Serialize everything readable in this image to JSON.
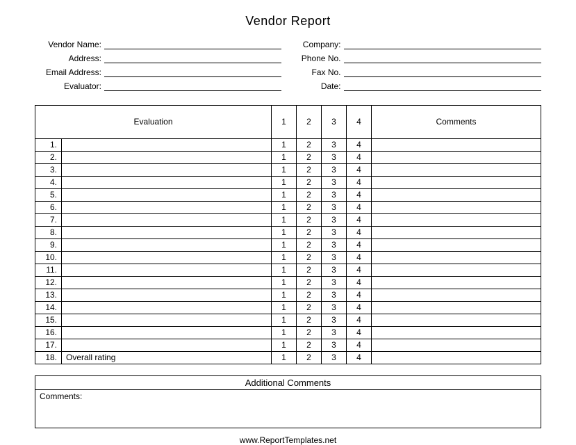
{
  "title": "Vendor Report",
  "info_left": [
    {
      "label": "Vendor Name:",
      "value": ""
    },
    {
      "label": "Address:",
      "value": ""
    },
    {
      "label": "Email Address:",
      "value": ""
    },
    {
      "label": "Evaluator:",
      "value": ""
    }
  ],
  "info_right": [
    {
      "label": "Company:",
      "value": ""
    },
    {
      "label": "Phone No.",
      "value": ""
    },
    {
      "label": "Fax No.",
      "value": ""
    },
    {
      "label": "Date:",
      "value": ""
    }
  ],
  "headers": {
    "evaluation": "Evaluation",
    "r1": "1",
    "r2": "2",
    "r3": "3",
    "r4": "4",
    "comments": "Comments"
  },
  "rows": [
    {
      "num": "1.",
      "label": "",
      "r1": "1",
      "r2": "2",
      "r3": "3",
      "r4": "4",
      "comments": ""
    },
    {
      "num": "2.",
      "label": "",
      "r1": "1",
      "r2": "2",
      "r3": "3",
      "r4": "4",
      "comments": ""
    },
    {
      "num": "3.",
      "label": "",
      "r1": "1",
      "r2": "2",
      "r3": "3",
      "r4": "4",
      "comments": ""
    },
    {
      "num": "4.",
      "label": "",
      "r1": "1",
      "r2": "2",
      "r3": "3",
      "r4": "4",
      "comments": ""
    },
    {
      "num": "5.",
      "label": "",
      "r1": "1",
      "r2": "2",
      "r3": "3",
      "r4": "4",
      "comments": ""
    },
    {
      "num": "6.",
      "label": "",
      "r1": "1",
      "r2": "2",
      "r3": "3",
      "r4": "4",
      "comments": ""
    },
    {
      "num": "7.",
      "label": "",
      "r1": "1",
      "r2": "2",
      "r3": "3",
      "r4": "4",
      "comments": ""
    },
    {
      "num": "8.",
      "label": "",
      "r1": "1",
      "r2": "2",
      "r3": "3",
      "r4": "4",
      "comments": ""
    },
    {
      "num": "9.",
      "label": "",
      "r1": "1",
      "r2": "2",
      "r3": "3",
      "r4": "4",
      "comments": ""
    },
    {
      "num": "10.",
      "label": "",
      "r1": "1",
      "r2": "2",
      "r3": "3",
      "r4": "4",
      "comments": ""
    },
    {
      "num": "11.",
      "label": "",
      "r1": "1",
      "r2": "2",
      "r3": "3",
      "r4": "4",
      "comments": ""
    },
    {
      "num": "12.",
      "label": "",
      "r1": "1",
      "r2": "2",
      "r3": "3",
      "r4": "4",
      "comments": ""
    },
    {
      "num": "13.",
      "label": "",
      "r1": "1",
      "r2": "2",
      "r3": "3",
      "r4": "4",
      "comments": ""
    },
    {
      "num": "14.",
      "label": "",
      "r1": "1",
      "r2": "2",
      "r3": "3",
      "r4": "4",
      "comments": ""
    },
    {
      "num": "15.",
      "label": "",
      "r1": "1",
      "r2": "2",
      "r3": "3",
      "r4": "4",
      "comments": ""
    },
    {
      "num": "16.",
      "label": "",
      "r1": "1",
      "r2": "2",
      "r3": "3",
      "r4": "4",
      "comments": ""
    },
    {
      "num": "17.",
      "label": "",
      "r1": "1",
      "r2": "2",
      "r3": "3",
      "r4": "4",
      "comments": ""
    },
    {
      "num": "18.",
      "label": "Overall rating",
      "r1": "1",
      "r2": "2",
      "r3": "3",
      "r4": "4",
      "comments": ""
    }
  ],
  "additional": {
    "header": "Additional Comments",
    "label": "Comments:",
    "value": ""
  },
  "footer": "www.ReportTemplates.net"
}
